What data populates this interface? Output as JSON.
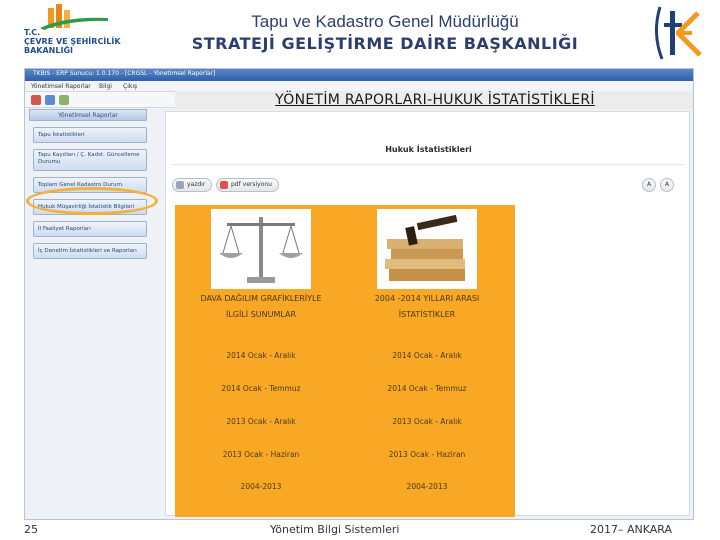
{
  "header": {
    "ministry_lines": "T.C.\nÇEVRE VE ŞEHİRCİLİK\nBAKANLIĞI",
    "title": "Tapu ve Kadastro Genel Müdürlüğü",
    "subtitle": "STRATEJİ GELİŞTİRME DAİRE BAŞKANLIĞI",
    "brand_colors": {
      "navy": "#2b3e6c",
      "orange": "#f9a825",
      "logo_orange": "#f39a1e"
    }
  },
  "app": {
    "window_title": "TKBIS - ERP        Sunucu: 1.0.170 -  [CRGSL - Yönetimsel Raporlar]",
    "menu": [
      "Yönetimsel Raporlar",
      "Bilgi",
      "Çıkış"
    ],
    "page_heading": "YÖNETİM RAPORLARI-HUKUK İSTATİSTİKLERİ",
    "sidebar": {
      "header": "Yönetimsel Raporlar",
      "items": [
        "Tapu İstatistikleri",
        "Tapu Kayıtları / Ç. Kadst. Güncelleme Durumu",
        "Toplam Genel Kadastro Durum.",
        "Hukuk Müşavirliği İstatistik Bilgileri",
        "İl Faaliyet Raporları",
        "İç Denetim İstatistikleri ve Raporları"
      ]
    },
    "panel": {
      "title": "Hukuk İstatistikleri",
      "print_label": "yazdır",
      "pdf_label": "pdf versiyonu",
      "font_buttons": [
        "A",
        "A"
      ]
    },
    "columns": [
      {
        "heading_line1": "DAVA DAĞILIM GRAFİKLERİYLE",
        "heading_line2": "İLGİLİ SUNUMLAR",
        "image_icon": "scales-of-justice-icon",
        "periods": [
          "2014 Ocak - Aralık",
          "2014 Ocak - Temmuz",
          "2013 Ocak - Aralık",
          "2013 Ocak - Haziran",
          "2004-2013"
        ]
      },
      {
        "heading_line1": "2004 -2014 YILLARI ARASI",
        "heading_line2": "İSTATİSTİKLER",
        "image_icon": "gavel-books-icon",
        "periods": [
          "2014 Ocak - Aralık",
          "2014 Ocak - Temmuz",
          "2013 Ocak - Aralık",
          "2013 Ocak - Haziran",
          "2004-2013"
        ]
      }
    ]
  },
  "footer": {
    "page_number": "25",
    "center": "Yönetim Bilgi Sistemleri",
    "right": "2017– ANKARA"
  }
}
